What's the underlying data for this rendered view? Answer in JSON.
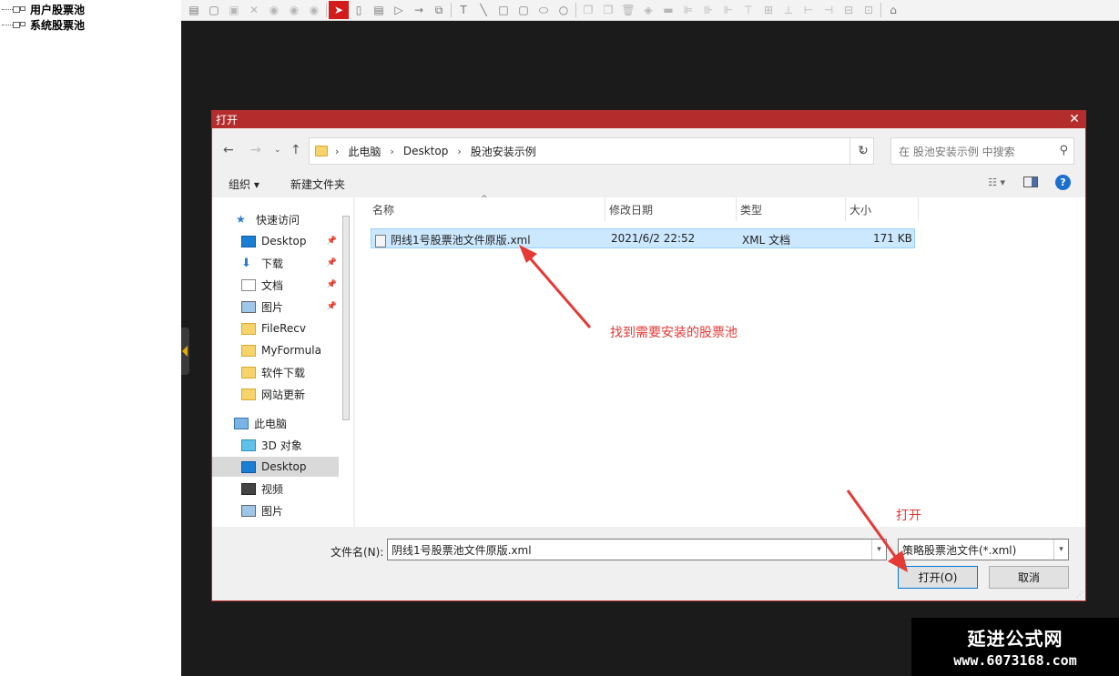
{
  "tree": {
    "items": [
      {
        "label": "用户股票池"
      },
      {
        "label": "系统股票池"
      }
    ]
  },
  "toolbar": {
    "icons": [
      "document-icon",
      "frame-icon",
      "save-icon",
      "delete-icon",
      "play-icon",
      "pause-icon",
      "stop-icon",
      "pointer-icon",
      "rounded-rect-icon",
      "note-icon",
      "triangle-play-icon",
      "arrow-icon",
      "copy-format-icon",
      "text-icon",
      "line-icon",
      "square-icon",
      "rounded-square-icon",
      "ellipse-icon",
      "circle-icon",
      "copy-icon",
      "paste-icon",
      "trash-icon",
      "fill-icon",
      "hline-icon",
      "align-left-icon",
      "align-center-icon",
      "align-right-icon",
      "align-top-icon",
      "align-middle-icon",
      "align-bottom-icon",
      "dist-horizontal-icon",
      "dist-vertical-icon",
      "same-width-icon",
      "same-height-icon",
      "group-icon"
    ]
  },
  "dialog": {
    "title": "打开",
    "breadcrumb": [
      "此电脑",
      "Desktop",
      "股池安装示例"
    ],
    "search_placeholder": "在 股池安装示例 中搜索",
    "organize_label": "组织 ▾",
    "new_folder_label": "新建文件夹",
    "help_label": "?",
    "nav_items": [
      {
        "label": "快速访问",
        "icon": "star-icon",
        "pinned": false
      },
      {
        "label": "Desktop",
        "icon": "desktop-icon",
        "pinned": true
      },
      {
        "label": "下载",
        "icon": "download-icon",
        "pinned": true
      },
      {
        "label": "文档",
        "icon": "document-icon",
        "pinned": true
      },
      {
        "label": "图片",
        "icon": "picture-icon",
        "pinned": true
      },
      {
        "label": "FileRecv",
        "icon": "folder-icon",
        "pinned": false
      },
      {
        "label": "MyFormula",
        "icon": "folder-icon",
        "pinned": false
      },
      {
        "label": "软件下载",
        "icon": "folder-icon",
        "pinned": false
      },
      {
        "label": "网站更新",
        "icon": "folder-icon",
        "pinned": false
      },
      {
        "label": "此电脑",
        "icon": "computer-icon",
        "pinned": false
      },
      {
        "label": "3D 对象",
        "icon": "cube-icon",
        "pinned": false
      },
      {
        "label": "Desktop",
        "icon": "desktop-icon",
        "pinned": false,
        "selected": true
      },
      {
        "label": "视频",
        "icon": "video-icon",
        "pinned": false
      },
      {
        "label": "图片",
        "icon": "picture-icon",
        "pinned": false
      }
    ],
    "columns": [
      "名称",
      "修改日期",
      "类型",
      "大小"
    ],
    "files": [
      {
        "name": "阴线1号股票池文件原版.xml",
        "date": "2021/6/2 22:52",
        "type": "XML 文档",
        "size": "171 KB"
      }
    ],
    "filename_label": "文件名(N):",
    "filename_value": "阴线1号股票池文件原版.xml",
    "filetype_value": "策略股票池文件(*.xml)",
    "open_button": "打开(O)",
    "cancel_button": "取消"
  },
  "annotations": {
    "find_pool": "找到需要安装的股票池",
    "open": "打开"
  },
  "watermark": {
    "title": "延进公式网",
    "url": "www.6073168.com"
  },
  "colors": {
    "accent_red": "#b52c2c",
    "annotation_red": "#e53935",
    "selection_blue": "#cce8ff"
  }
}
